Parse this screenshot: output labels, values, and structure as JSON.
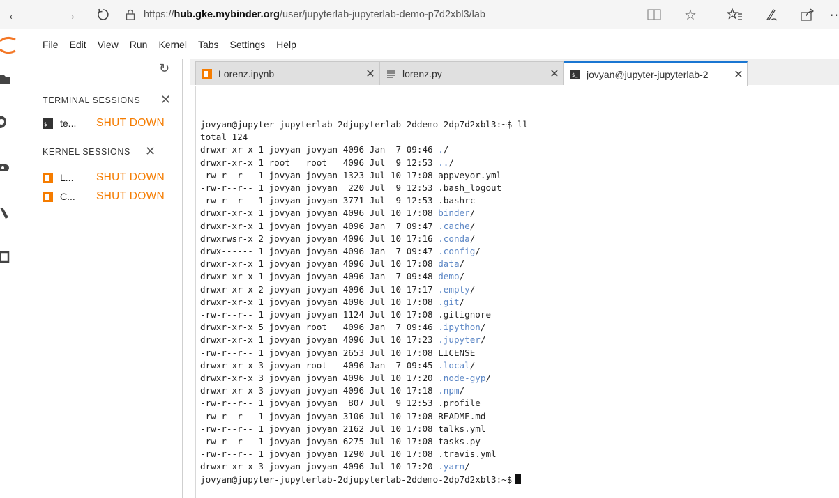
{
  "browser": {
    "url_prefix": "https://",
    "url_host": "hub.gke.mybinder.org",
    "url_path": "/user/jupyterlab-jupyterlab-demo-p7d2xbl3/lab"
  },
  "menu": [
    "File",
    "Edit",
    "View",
    "Run",
    "Kernel",
    "Tabs",
    "Settings",
    "Help"
  ],
  "left_panel": {
    "terminal_header": "TERMINAL SESSIONS",
    "kernel_header": "KERNEL SESSIONS",
    "terminal_sessions": [
      {
        "name": "te...",
        "action": "SHUT DOWN"
      }
    ],
    "kernel_sessions": [
      {
        "name": "L...",
        "action": "SHUT DOWN"
      },
      {
        "name": "C...",
        "action": "SHUT DOWN"
      }
    ]
  },
  "tabs": [
    {
      "label": "Lorenz.ipynb",
      "icon": "notebook-icon"
    },
    {
      "label": "lorenz.py",
      "icon": "text-file-icon"
    },
    {
      "label": "jovyan@jupyter-jupyterlab-2",
      "icon": "terminal-icon"
    }
  ],
  "terminal": {
    "prompt": "jovyan@jupyter-jupyterlab-2djupyterlab-2ddemo-2dp7d2xbl3:~$",
    "command": "ll",
    "total": "total 124",
    "entries": [
      {
        "perm": "drwxr-xr-x 1 jovyan jovyan 4096 Jan  7 09:46 ",
        "name": ".",
        "dir": true
      },
      {
        "perm": "drwxr-xr-x 1 root   root   4096 Jul  9 12:53 ",
        "name": "..",
        "dir": true
      },
      {
        "perm": "-rw-r--r-- 1 jovyan jovyan 1323 Jul 10 17:08 ",
        "name": "appveyor.yml",
        "dir": false
      },
      {
        "perm": "-rw-r--r-- 1 jovyan jovyan  220 Jul  9 12:53 ",
        "name": ".bash_logout",
        "dir": false
      },
      {
        "perm": "-rw-r--r-- 1 jovyan jovyan 3771 Jul  9 12:53 ",
        "name": ".bashrc",
        "dir": false
      },
      {
        "perm": "drwxr-xr-x 1 jovyan jovyan 4096 Jul 10 17:08 ",
        "name": "binder",
        "dir": true
      },
      {
        "perm": "drwxr-xr-x 1 jovyan jovyan 4096 Jan  7 09:47 ",
        "name": ".cache",
        "dir": true
      },
      {
        "perm": "drwxrwsr-x 2 jovyan jovyan 4096 Jul 10 17:16 ",
        "name": ".conda",
        "dir": true
      },
      {
        "perm": "drwx------ 1 jovyan jovyan 4096 Jan  7 09:47 ",
        "name": ".config",
        "dir": true
      },
      {
        "perm": "drwxr-xr-x 1 jovyan jovyan 4096 Jul 10 17:08 ",
        "name": "data",
        "dir": true
      },
      {
        "perm": "drwxr-xr-x 1 jovyan jovyan 4096 Jan  7 09:48 ",
        "name": "demo",
        "dir": true
      },
      {
        "perm": "drwxr-xr-x 2 jovyan jovyan 4096 Jul 10 17:17 ",
        "name": ".empty",
        "dir": true
      },
      {
        "perm": "drwxr-xr-x 1 jovyan jovyan 4096 Jul 10 17:08 ",
        "name": ".git",
        "dir": true
      },
      {
        "perm": "-rw-r--r-- 1 jovyan jovyan 1124 Jul 10 17:08 ",
        "name": ".gitignore",
        "dir": false
      },
      {
        "perm": "drwxr-xr-x 5 jovyan root   4096 Jan  7 09:46 ",
        "name": ".ipython",
        "dir": true
      },
      {
        "perm": "drwxr-xr-x 1 jovyan jovyan 4096 Jul 10 17:23 ",
        "name": ".jupyter",
        "dir": true
      },
      {
        "perm": "-rw-r--r-- 1 jovyan jovyan 2653 Jul 10 17:08 ",
        "name": "LICENSE",
        "dir": false
      },
      {
        "perm": "drwxr-xr-x 3 jovyan root   4096 Jan  7 09:45 ",
        "name": ".local",
        "dir": true
      },
      {
        "perm": "drwxr-xr-x 3 jovyan jovyan 4096 Jul 10 17:20 ",
        "name": ".node-gyp",
        "dir": true
      },
      {
        "perm": "drwxr-xr-x 3 jovyan jovyan 4096 Jul 10 17:18 ",
        "name": ".npm",
        "dir": true
      },
      {
        "perm": "-rw-r--r-- 1 jovyan jovyan  807 Jul  9 12:53 ",
        "name": ".profile",
        "dir": false
      },
      {
        "perm": "-rw-r--r-- 1 jovyan jovyan 3106 Jul 10 17:08 ",
        "name": "README.md",
        "dir": false
      },
      {
        "perm": "-rw-r--r-- 1 jovyan jovyan 2162 Jul 10 17:08 ",
        "name": "talks.yml",
        "dir": false
      },
      {
        "perm": "-rw-r--r-- 1 jovyan jovyan 6275 Jul 10 17:08 ",
        "name": "tasks.py",
        "dir": false
      },
      {
        "perm": "-rw-r--r-- 1 jovyan jovyan 1290 Jul 10 17:08 ",
        "name": ".travis.yml",
        "dir": false
      },
      {
        "perm": "drwxr-xr-x 3 jovyan jovyan 4096 Jul 10 17:20 ",
        "name": ".yarn",
        "dir": true
      }
    ],
    "final_prompt": "jovyan@jupyter-jupyterlab-2djupyterlab-2ddemo-2dp7d2xbl3:~$"
  },
  "colors": {
    "accent_orange": "#f57c00",
    "dir_blue": "#5b86c5",
    "active_tab": "#1976d2"
  }
}
